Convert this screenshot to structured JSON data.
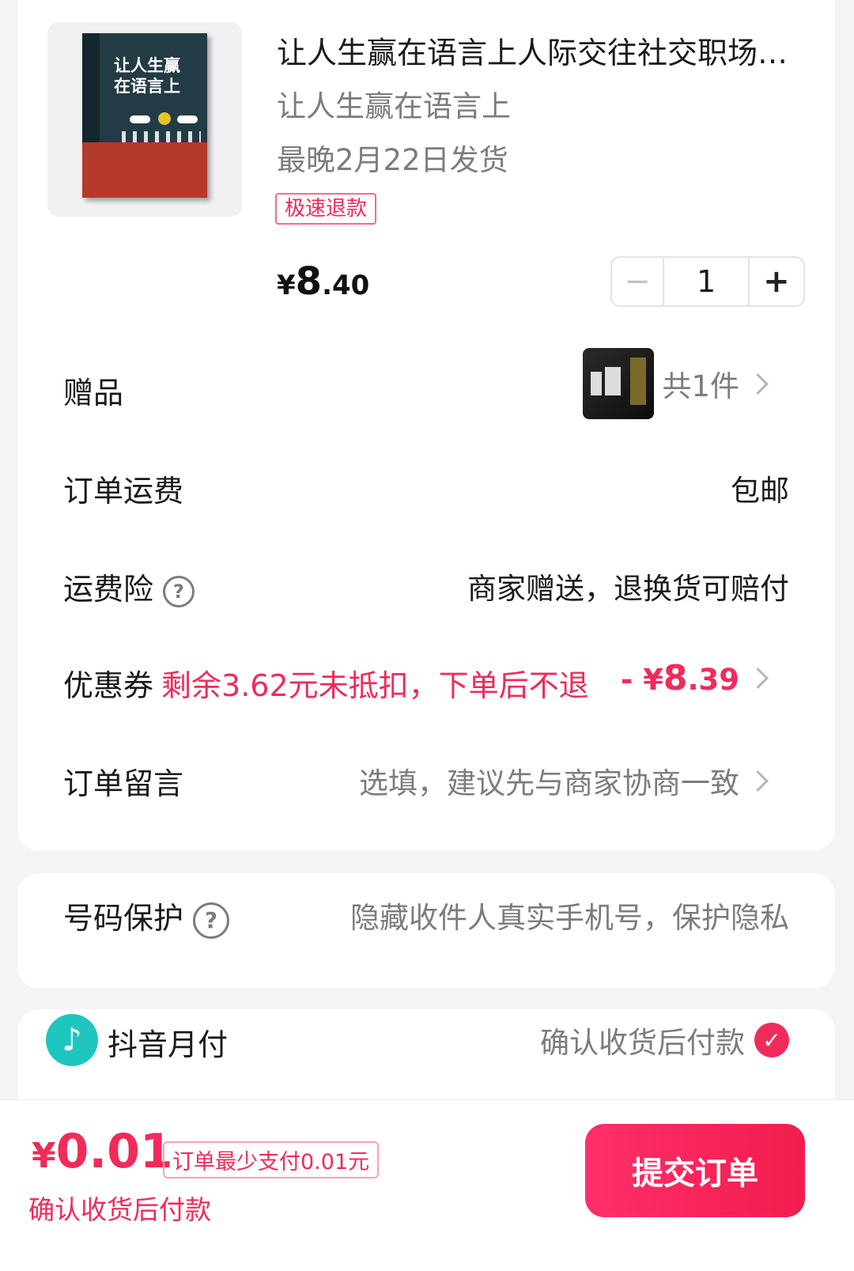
{
  "product": {
    "title": "让人生赢在语言上人际交往社交职场…",
    "sku": "让人生赢在语言上",
    "ship_by": "最晚2月22日发货",
    "tag": "极速退款",
    "cover_title": "让人生赢在语言上",
    "price_currency": "¥",
    "price_int": "8",
    "price_dec": ".40",
    "quantity": "1",
    "minus_symbol": "−",
    "plus_symbol": "+"
  },
  "rows": {
    "gift": {
      "label": "赠品",
      "value": "共1件"
    },
    "shipping": {
      "label": "订单运费",
      "value": "包邮"
    },
    "insurance": {
      "label": "运费险",
      "value": "商家赠送，退换货可赔付"
    },
    "coupon": {
      "label": "优惠券",
      "note": "剩余3.62元未抵扣，下单后不退",
      "value_prefix": "- ¥",
      "value_int": "8",
      "value_dec": ".39"
    },
    "message": {
      "label": "订单留言",
      "placeholder": "选填，建议先与商家协商一致"
    }
  },
  "privacy": {
    "label": "号码保护",
    "value": "隐藏收件人真实手机号，保护隐私"
  },
  "payment": {
    "label": "抖音月付",
    "value": "确认收货后付款"
  },
  "footer": {
    "total_currency": "¥",
    "total_value": "0.01",
    "min_note": "订单最少支付0.01元",
    "pay_note": "确认收货后付款",
    "submit_label": "提交订单"
  },
  "icons": {
    "chevron": "chevron-right-icon",
    "question": "question-circle-icon",
    "tiktok": "tiktok-logo-icon",
    "check": "check-circle-icon"
  },
  "colors": {
    "accent": "#f02b5a",
    "teal": "#1fc6c0",
    "muted": "#7c7c80"
  }
}
